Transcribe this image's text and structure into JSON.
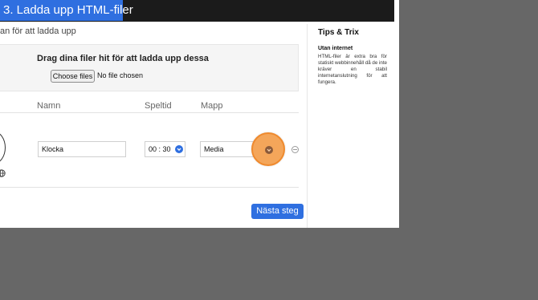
{
  "header": {
    "title": "3. Ladda upp HTML-filer"
  },
  "main": {
    "subtitle": "an för att ladda upp",
    "dropzone": {
      "text": "Drag dina filer hit för att ladda upp dessa",
      "choose_label": "Choose files",
      "no_file_text": "No file chosen"
    },
    "columns": {
      "name": "Namn",
      "playtime": "Speltid",
      "folder": "Mapp"
    },
    "row": {
      "name_value": "Klocka",
      "playtime_value": "00 : 30",
      "folder_value": "Media"
    },
    "next_label": "Nästa steg"
  },
  "sidebar": {
    "title": "Tips & Trix",
    "tip_heading": "Utan internet",
    "tip_body": "HTML-filer är extra bra för statiskt webbinnehåll då de inte kräver en stabil internetanslutning för att fungera."
  },
  "colors": {
    "accent": "#2f6fe0",
    "highlight": "#f4a65a",
    "titlebar": "#1b1b1b",
    "desktop": "#676767"
  },
  "icons": [
    "chevron-down-icon",
    "globe-icon",
    "more-icon",
    "avatar"
  ]
}
